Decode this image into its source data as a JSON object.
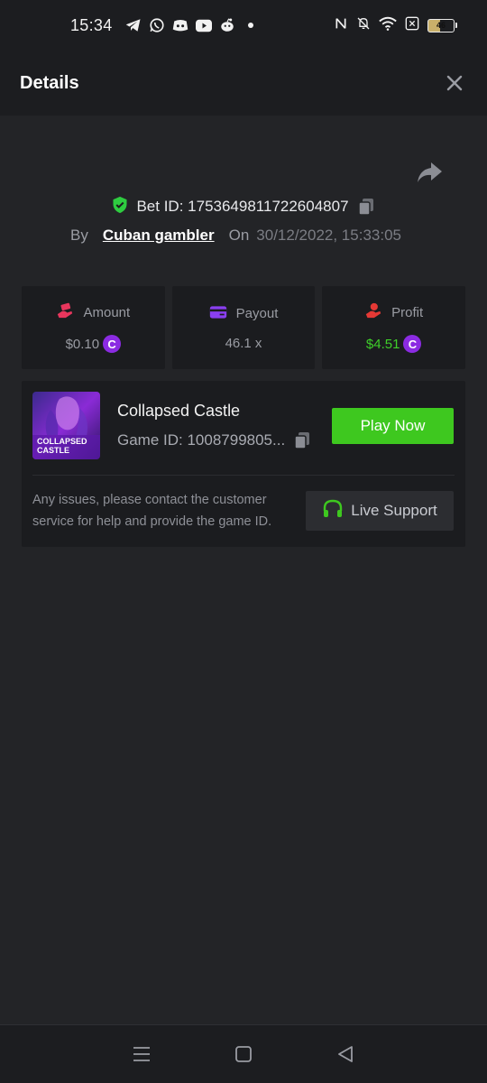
{
  "status_bar": {
    "time": "15:34",
    "app_icons": [
      "telegram-icon",
      "whatsapp-icon",
      "discord-icon",
      "youtube-icon",
      "reddit-icon",
      "dot-icon"
    ],
    "right_icons": [
      "nfc-icon",
      "bell-muted-icon",
      "wifi-icon",
      "close-box-icon"
    ],
    "battery": "46"
  },
  "header": {
    "title": "Details",
    "close_icon": "close-icon"
  },
  "bet": {
    "id_label": "Bet ID: 1753649811722604807",
    "by_label": "By",
    "user": "Cuban gambler",
    "on_label": "On",
    "date": "30/12/2022, 15:33:05"
  },
  "stats": [
    {
      "label": "Amount",
      "value": "$0.10",
      "icon": "money-hand-icon",
      "color": "#e8365d"
    },
    {
      "label": "Payout",
      "value": "46.1 x",
      "icon": "card-icon",
      "color": "#8a3ff0"
    },
    {
      "label": "Profit",
      "value": "$4.51",
      "icon": "profit-hand-icon",
      "color": "#e53935"
    }
  ],
  "game": {
    "thumb_text_line1": "COLLAPSED",
    "thumb_text_line2": "CASTLE",
    "name": "Collapsed Castle",
    "id_label": "Game ID: 1008799805...",
    "play_label": "Play Now",
    "support_text": "Any issues, please contact the customer service for help and provide the game ID.",
    "support_label": "Live Support"
  },
  "colors": {
    "accent_green": "#3ec81f",
    "coin_purple": "#8b2be2",
    "shield_green": "#2ecc40"
  }
}
